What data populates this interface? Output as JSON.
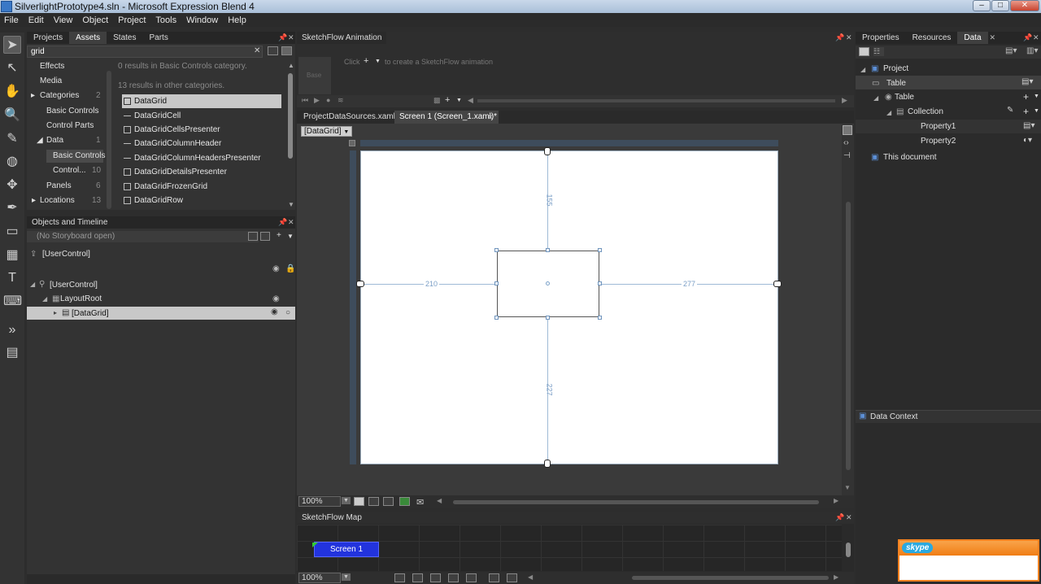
{
  "window": {
    "title": "SilverlightPrototype4.sln - Microsoft Expression Blend 4",
    "min": "–",
    "max": "□",
    "close": "✕"
  },
  "menu": [
    "File",
    "Edit",
    "View",
    "Object",
    "Project",
    "Tools",
    "Window",
    "Help"
  ],
  "left_top": {
    "tabs": [
      "Projects",
      "Assets",
      "States",
      "Parts"
    ],
    "search_value": "grid",
    "categories": [
      {
        "label": "Effects",
        "count": ""
      },
      {
        "label": "Media",
        "count": ""
      },
      {
        "label": "Categories",
        "count": "2"
      },
      {
        "label": "Basic Controls",
        "count": ""
      },
      {
        "label": "Control Parts",
        "count": ""
      },
      {
        "label": "Data",
        "count": "1"
      },
      {
        "label": "Basic Controls",
        "count": ""
      },
      {
        "label": "Control...",
        "count": "10"
      },
      {
        "label": "Panels",
        "count": "6"
      },
      {
        "label": "Locations",
        "count": "13"
      }
    ],
    "results_basic": "0 results in Basic Controls category.",
    "results_other": "13 results in other categories.",
    "assets": [
      "DataGrid",
      "DataGridCell",
      "DataGridCellsPresenter",
      "DataGridColumnHeader",
      "DataGridColumnHeadersPresenter",
      "DataGridDetailsPresenter",
      "DataGridFrozenGrid",
      "DataGridRow"
    ]
  },
  "objects": {
    "title": "Objects and Timeline",
    "storyboard": "(No Storyboard open)",
    "items": [
      "[UserControl]",
      "[UserControl]",
      "LayoutRoot",
      "[DataGrid]"
    ]
  },
  "animation": {
    "title": "SketchFlow Animation",
    "hint_click": "Click",
    "hint_rest": "to create a SketchFlow animation",
    "base": "Base"
  },
  "doc_tabs": [
    "ProjectDataSources.xaml*",
    "Screen 1 (Screen_1.xaml)*"
  ],
  "breadcrumb": "[DataGrid]",
  "measures": {
    "top": "155",
    "left": "210",
    "right": "277",
    "bottom": "227"
  },
  "zoom": "100%",
  "map": {
    "title": "SketchFlow Map",
    "screen": "Screen 1",
    "zoom": "100%"
  },
  "right": {
    "tabs": [
      "Properties",
      "Resources",
      "Data"
    ],
    "tree": [
      "Project",
      "Table",
      "Table",
      "Collection",
      "Property1",
      "Property2",
      "This document"
    ],
    "data_context": "Data Context"
  },
  "skype": {
    "label": "skype"
  },
  "colors": {
    "accent": "#3a78c6",
    "screen_node": "#2233dd",
    "skype": "#f58220"
  }
}
